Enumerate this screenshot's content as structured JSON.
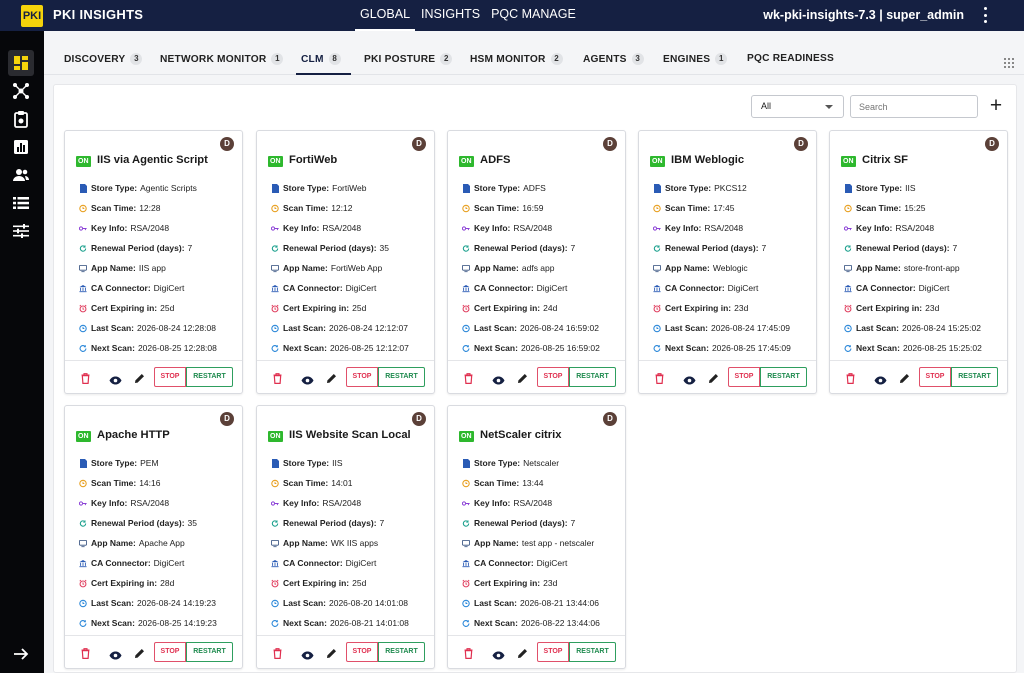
{
  "app": {
    "logo_text": "PKI",
    "brand": "PKI INSIGHTS",
    "user": "wk-pki-insights-7.3  | super_admin"
  },
  "topnav": [
    {
      "label": "GLOBAL",
      "active": true
    },
    {
      "label": "INSIGHTS"
    },
    {
      "label": "PQC MANAGE"
    }
  ],
  "tabs": [
    {
      "label": "DISCOVERY",
      "count": "3"
    },
    {
      "label": "NETWORK MONITOR",
      "count": "1"
    },
    {
      "label": "CLM",
      "count": "8",
      "active": true
    },
    {
      "label": "PKI POSTURE",
      "count": "2"
    },
    {
      "label": "HSM MONITOR",
      "count": "2"
    },
    {
      "label": "AGENTS",
      "count": "3"
    },
    {
      "label": "ENGINES",
      "count": "1"
    },
    {
      "label": "PQC READINESS"
    }
  ],
  "filter": {
    "selected": "All",
    "search_placeholder": "Search"
  },
  "field_labels": {
    "store_type": "Store Type:",
    "scan_time": "Scan Time:",
    "key_info": "Key Info:",
    "renewal": "Renewal Period (days):",
    "app_name": "App Name:",
    "ca": "CA Connector:",
    "expiring": "Cert Expiring in:",
    "last_scan": "Last Scan:",
    "next_scan": "Next Scan:"
  },
  "badges": {
    "on": "ON",
    "d": "D"
  },
  "buttons": {
    "stop": "STOP",
    "restart": "RESTART"
  },
  "colors": {
    "navy": "#152042",
    "on_green": "#2eb82e",
    "stop_red": "#e03050",
    "restart_green": "#1e8a4e",
    "logo_yellow": "#f5d30b"
  },
  "cards": [
    {
      "title": "IIS via Agentic Script",
      "store_type": "Agentic Scripts",
      "scan_time": "12:28",
      "key_info": "RSA/2048",
      "renewal": "7",
      "app_name": "IIS app",
      "ca": "DigiCert",
      "expiring": "25d",
      "last_scan": "2026-08-24 12:28:08",
      "next_scan": "2026-08-25 12:28:08"
    },
    {
      "title": "FortiWeb",
      "store_type": "FortiWeb",
      "scan_time": "12:12",
      "key_info": "RSA/2048",
      "renewal": "35",
      "app_name": "FortiWeb App",
      "ca": "DigiCert",
      "expiring": "25d",
      "last_scan": "2026-08-24 12:12:07",
      "next_scan": "2026-08-25 12:12:07"
    },
    {
      "title": "ADFS",
      "store_type": "ADFS",
      "scan_time": "16:59",
      "key_info": "RSA/2048",
      "renewal": "7",
      "app_name": "adfs app",
      "ca": "DigiCert",
      "expiring": "24d",
      "last_scan": "2026-08-24 16:59:02",
      "next_scan": "2026-08-25 16:59:02"
    },
    {
      "title": "IBM Weblogic",
      "store_type": "PKCS12",
      "scan_time": "17:45",
      "key_info": "RSA/2048",
      "renewal": "7",
      "app_name": "Weblogic",
      "ca": "DigiCert",
      "expiring": "23d",
      "last_scan": "2026-08-24 17:45:09",
      "next_scan": "2026-08-25 17:45:09"
    },
    {
      "title": "Citrix SF",
      "store_type": "IIS",
      "scan_time": "15:25",
      "key_info": "RSA/2048",
      "renewal": "7",
      "app_name": "store-front-app",
      "ca": "DigiCert",
      "expiring": "23d",
      "last_scan": "2026-08-24 15:25:02",
      "next_scan": "2026-08-25 15:25:02"
    },
    {
      "title": "Apache HTTP",
      "store_type": "PEM",
      "scan_time": "14:16",
      "key_info": "RSA/2048",
      "renewal": "35",
      "app_name": "Apache App",
      "ca": "DigiCert",
      "expiring": "28d",
      "last_scan": "2026-08-24 14:19:23",
      "next_scan": "2026-08-25 14:19:23"
    },
    {
      "title": "IIS Website Scan Local",
      "store_type": "IIS",
      "scan_time": "14:01",
      "key_info": "RSA/2048",
      "renewal": "7",
      "app_name": "WK IIS apps",
      "ca": "DigiCert",
      "expiring": "25d",
      "last_scan": "2026-08-20 14:01:08",
      "next_scan": "2026-08-21 14:01:08"
    },
    {
      "title": "NetScaler citrix",
      "store_type": "Netscaler",
      "scan_time": "13:44",
      "key_info": "RSA/2048",
      "renewal": "7",
      "app_name": "test app - netscaler",
      "ca": "DigiCert",
      "expiring": "23d",
      "last_scan": "2026-08-21 13:44:06",
      "next_scan": "2026-08-22 13:44:06"
    }
  ]
}
